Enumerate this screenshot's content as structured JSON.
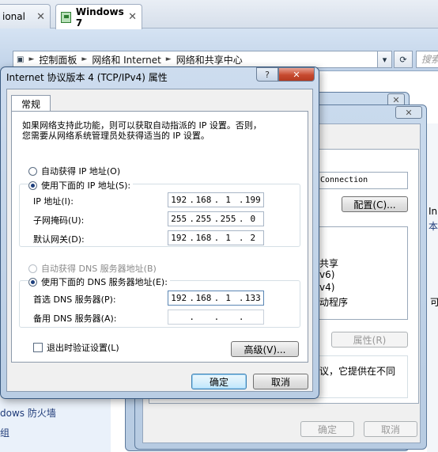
{
  "vm_tabs": [
    {
      "label": "ional",
      "close": "✕"
    },
    {
      "label": "Windows 7",
      "close": "✕"
    }
  ],
  "explorer": {
    "breadcrumb": [
      "控制面板",
      "网络和 Internet",
      "网络和共享中心"
    ],
    "search_placeholder": "搜索",
    "left_items": [
      "dows 防火墙",
      "组"
    ]
  },
  "adapter_dialog": {
    "connection_name": "Connection",
    "configure_button": "配置(C)...",
    "items": [
      "共享",
      "v6)",
      "v4)",
      "动程序"
    ],
    "properties_button": "属性(R)",
    "description": "议，它提供在不同",
    "ok_button": "确定",
    "cancel_button": "取消",
    "side_text": [
      "In",
      "本",
      "可"
    ]
  },
  "tcpip_dialog": {
    "title": "Internet 协议版本 4 (TCP/IPv4) 属性",
    "tab_general": "常规",
    "description": [
      "如果网络支持此功能，则可以获取自动指派的 IP 设置。否则，",
      "您需要从网络系统管理员处获得适当的 IP 设置。"
    ],
    "auto_ip_label": "自动获得 IP 地址(O)",
    "manual_ip_label": "使用下面的 IP 地址(S):",
    "ip_address_label": "IP 地址(I):",
    "ip_address": [
      "192",
      "168",
      "1",
      "199"
    ],
    "subnet_label": "子网掩码(U):",
    "subnet": [
      "255",
      "255",
      "255",
      "0"
    ],
    "gateway_label": "默认网关(D):",
    "gateway": [
      "192",
      "168",
      "1",
      "2"
    ],
    "auto_dns_label": "自动获得 DNS 服务器地址(B)",
    "manual_dns_label": "使用下面的 DNS 服务器地址(E):",
    "preferred_dns_label": "首选 DNS 服务器(P):",
    "preferred_dns": [
      "192",
      "168",
      "1",
      "133"
    ],
    "alternate_dns_label": "备用 DNS 服务器(A):",
    "alternate_dns": [
      "",
      "",
      "",
      ""
    ],
    "validate_label": "退出时验证设置(L)",
    "advanced_button": "高级(V)...",
    "ok_button": "确定",
    "cancel_button": "取消",
    "selected_ip_mode": "manual",
    "selected_dns_mode": "manual",
    "validate_checked": false
  },
  "colors": {
    "title_bar": "#b9cde4",
    "close_button": "#c74a2f",
    "link_text": "#1e3a78"
  }
}
